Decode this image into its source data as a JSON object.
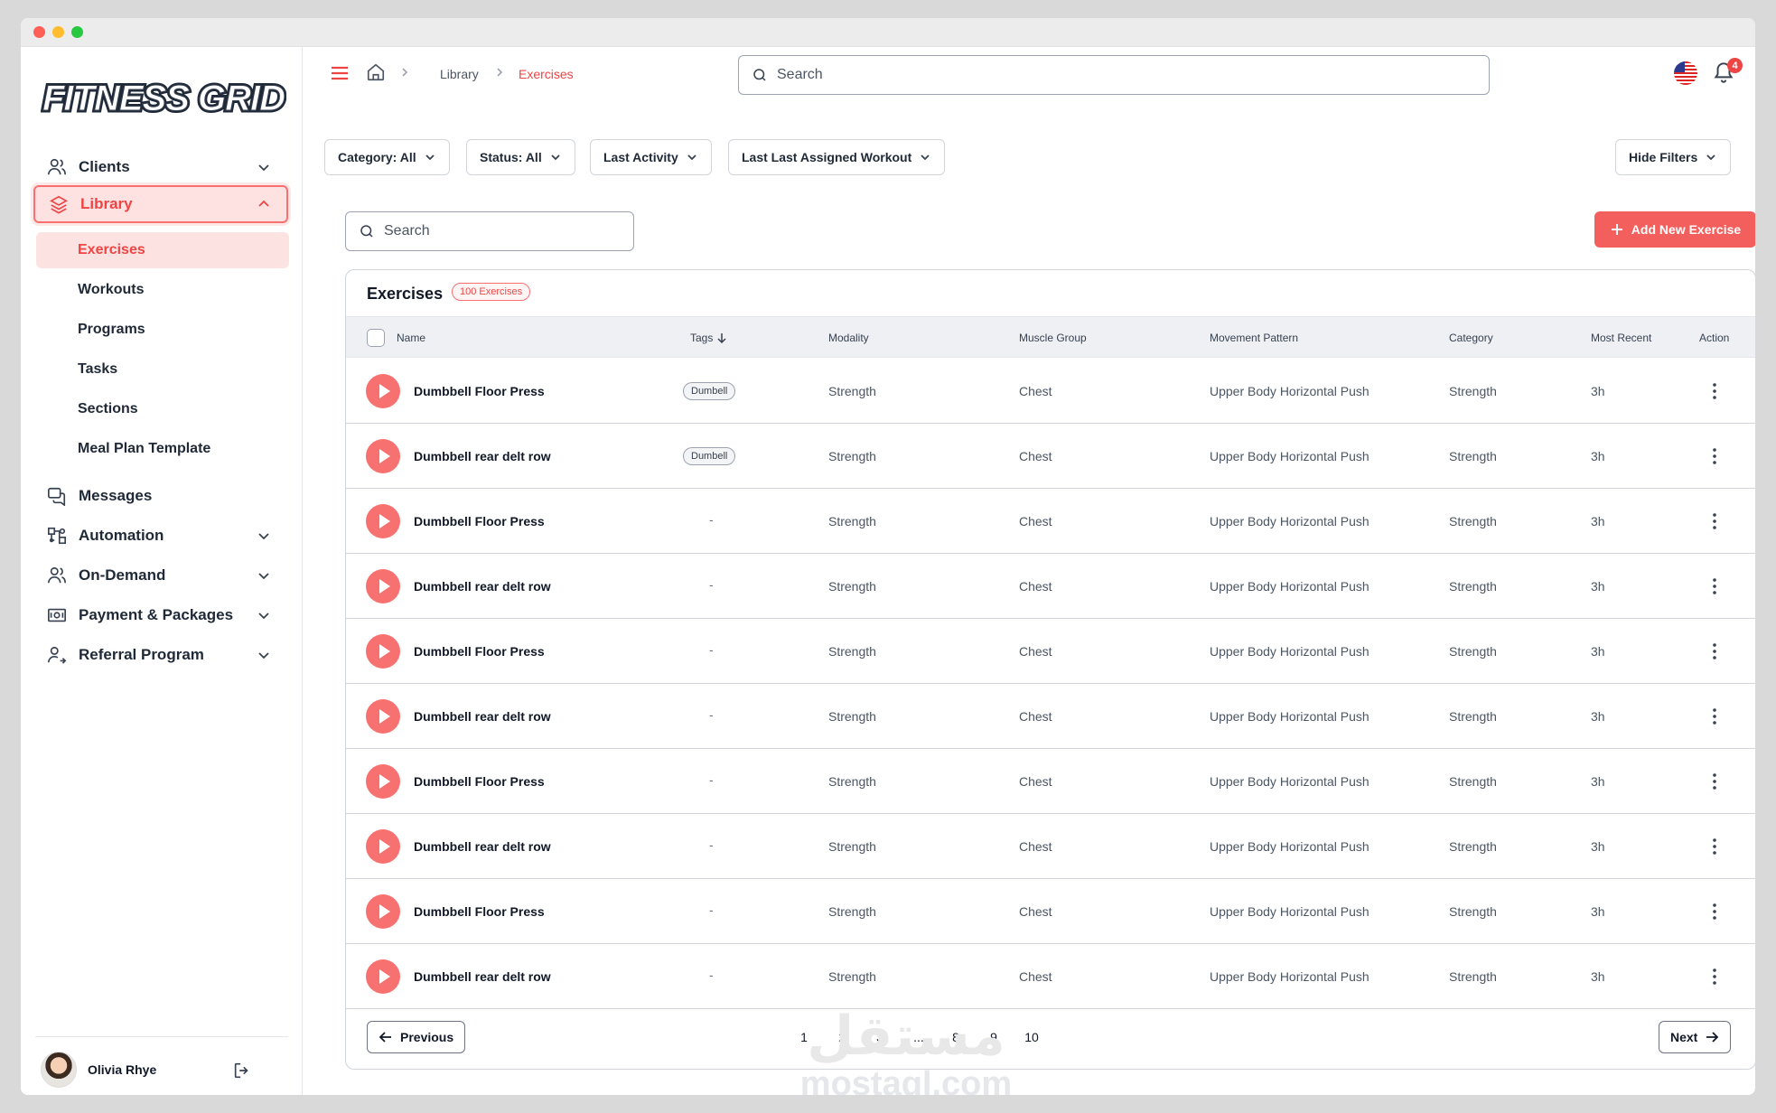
{
  "brand": {
    "name": "FITNESS GRID",
    "accent": "#f25f5c"
  },
  "sidebar": {
    "items": [
      {
        "label": "Clients",
        "icon": "users-icon",
        "expandable": true
      },
      {
        "label": "Library",
        "icon": "layers-icon",
        "expandable": true,
        "active": true
      },
      {
        "label": "Messages",
        "icon": "messages-icon"
      },
      {
        "label": "Automation",
        "icon": "automation-icon",
        "expandable": true
      },
      {
        "label": "On-Demand",
        "icon": "users-icon",
        "expandable": true
      },
      {
        "label": "Payment & Packages",
        "icon": "money-icon",
        "expandable": true
      },
      {
        "label": "Referral Program",
        "icon": "user-share-icon",
        "expandable": true
      }
    ],
    "library_sub": [
      "Exercises",
      "Workouts",
      "Programs",
      "Tasks",
      "Sections",
      "Meal Plan Template"
    ],
    "user": {
      "name": "Olivia Rhye"
    }
  },
  "topbar": {
    "breadcrumb": [
      "Library",
      "Exercises"
    ],
    "search_placeholder": "Search",
    "notifications": "4"
  },
  "filters": [
    "Category: All",
    "Status: All",
    "Last Activity",
    "Last Last Assigned Workout"
  ],
  "hide_filters": "Hide Filters",
  "search_placeholder": "Search",
  "add_button": "Add New Exercise",
  "table": {
    "title": "Exercises",
    "count_badge": "100 Exercises",
    "columns": [
      "Name",
      "Tags",
      "Modality",
      "Muscle Group",
      "Movement Pattern",
      "Category",
      "Most Recent",
      "Action"
    ],
    "rows": [
      {
        "name": "Dumbbell Floor Press",
        "tag": "Dumbell",
        "modality": "Strength",
        "muscle": "Chest",
        "pattern": "Upper Body Horizontal Push",
        "category": "Strength",
        "recent": "3h"
      },
      {
        "name": "Dumbbell rear delt row",
        "tag": "Dumbell",
        "modality": "Strength",
        "muscle": "Chest",
        "pattern": "Upper Body Horizontal Push",
        "category": "Strength",
        "recent": "3h"
      },
      {
        "name": "Dumbbell Floor Press",
        "tag": "-",
        "modality": "Strength",
        "muscle": "Chest",
        "pattern": "Upper Body Horizontal Push",
        "category": "Strength",
        "recent": "3h"
      },
      {
        "name": "Dumbbell rear delt row",
        "tag": "-",
        "modality": "Strength",
        "muscle": "Chest",
        "pattern": "Upper Body Horizontal Push",
        "category": "Strength",
        "recent": "3h"
      },
      {
        "name": "Dumbbell Floor Press",
        "tag": "-",
        "modality": "Strength",
        "muscle": "Chest",
        "pattern": "Upper Body Horizontal Push",
        "category": "Strength",
        "recent": "3h"
      },
      {
        "name": "Dumbbell rear delt row",
        "tag": "-",
        "modality": "Strength",
        "muscle": "Chest",
        "pattern": "Upper Body Horizontal Push",
        "category": "Strength",
        "recent": "3h"
      },
      {
        "name": "Dumbbell Floor Press",
        "tag": "-",
        "modality": "Strength",
        "muscle": "Chest",
        "pattern": "Upper Body Horizontal Push",
        "category": "Strength",
        "recent": "3h"
      },
      {
        "name": "Dumbbell rear delt row",
        "tag": "-",
        "modality": "Strength",
        "muscle": "Chest",
        "pattern": "Upper Body Horizontal Push",
        "category": "Strength",
        "recent": "3h"
      },
      {
        "name": "Dumbbell Floor Press",
        "tag": "-",
        "modality": "Strength",
        "muscle": "Chest",
        "pattern": "Upper Body Horizontal Push",
        "category": "Strength",
        "recent": "3h"
      },
      {
        "name": "Dumbbell rear delt row",
        "tag": "-",
        "modality": "Strength",
        "muscle": "Chest",
        "pattern": "Upper Body Horizontal Push",
        "category": "Strength",
        "recent": "3h"
      }
    ]
  },
  "pagination": {
    "previous": "Previous",
    "next": "Next",
    "pages": [
      "1",
      "2",
      "3",
      "...",
      "8",
      "9",
      "10"
    ],
    "current": "1"
  },
  "watermark": {
    "arabic": "مستقل",
    "latin": "mostaql.com"
  }
}
